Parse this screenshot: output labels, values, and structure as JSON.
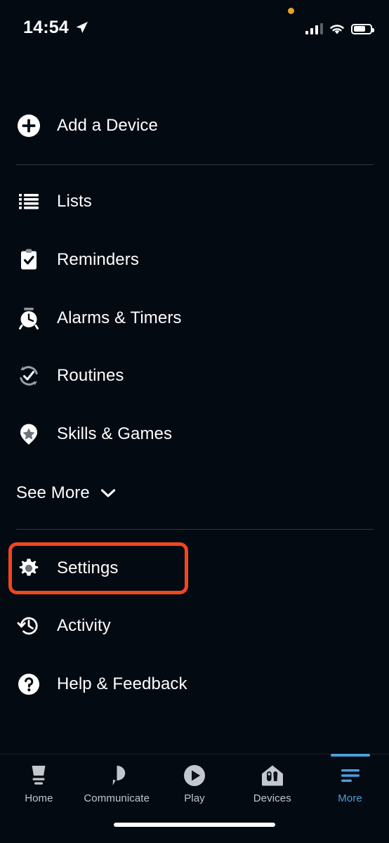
{
  "status_bar": {
    "time": "14:54",
    "location_icon": "location-arrow-icon",
    "recording_dot": "orange-privacy-dot",
    "signal_icon": "cellular-signal-icon",
    "signal_bars_filled": 3,
    "signal_bars_total": 4,
    "wifi_icon": "wifi-icon",
    "battery_icon": "battery-icon",
    "battery_level_percent": 64
  },
  "menu": {
    "add_device": {
      "label": "Add a Device",
      "icon": "plus-circle-icon"
    },
    "items": [
      {
        "label": "Lists",
        "icon": "list-icon"
      },
      {
        "label": "Reminders",
        "icon": "clipboard-check-icon"
      },
      {
        "label": "Alarms & Timers",
        "icon": "alarm-clock-icon"
      },
      {
        "label": "Routines",
        "icon": "routines-refresh-check-icon"
      },
      {
        "label": "Skills & Games",
        "icon": "map-pin-star-icon"
      }
    ],
    "see_more": {
      "label": "See More",
      "icon": "chevron-down-icon"
    },
    "secondary_items": [
      {
        "label": "Settings",
        "icon": "gear-icon",
        "highlighted": true
      },
      {
        "label": "Activity",
        "icon": "history-clock-icon",
        "highlighted": false
      },
      {
        "label": "Help & Feedback",
        "icon": "question-circle-icon",
        "highlighted": false
      }
    ]
  },
  "highlight": {
    "target": "Settings",
    "color": "#f2461f"
  },
  "tab_bar": {
    "active_tab": "More",
    "active_color": "#4a9fdc",
    "inactive_color": "#c2c8ce",
    "tabs": [
      {
        "label": "Home",
        "icon": "echo-device-icon"
      },
      {
        "label": "Communicate",
        "icon": "speech-bubble-icon"
      },
      {
        "label": "Play",
        "icon": "play-circle-icon"
      },
      {
        "label": "Devices",
        "icon": "home-devices-icon"
      },
      {
        "label": "More",
        "icon": "hamburger-menu-icon"
      }
    ]
  },
  "home_indicator": "home-indicator-bar"
}
